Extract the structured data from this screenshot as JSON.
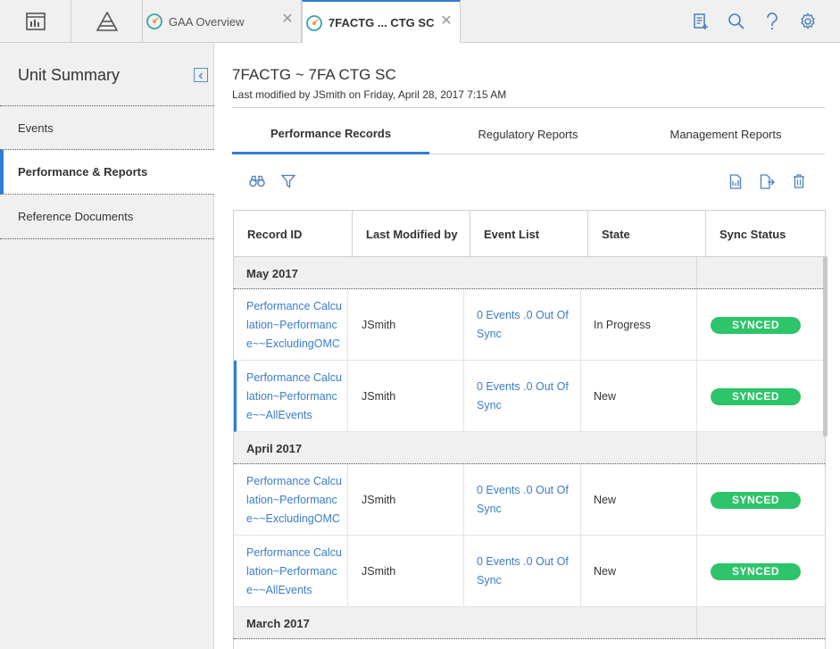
{
  "topbar": {
    "tabs": [
      {
        "label": "GAA Overview",
        "active": false
      },
      {
        "label": "7FACTG ... CTG SC",
        "active": true
      }
    ],
    "close_glyph": "✕"
  },
  "sidebar": {
    "title": "Unit Summary",
    "items": [
      {
        "label": "Events",
        "active": false
      },
      {
        "label": "Performance & Reports",
        "active": true
      },
      {
        "label": "Reference Documents",
        "active": false
      }
    ]
  },
  "main": {
    "title": "7FACTG ~ 7FA CTG SC",
    "subtitle": "Last modified by JSmith on Friday, April 28, 2017 7:15 AM",
    "tabs": [
      {
        "label": "Performance Records",
        "active": true
      },
      {
        "label": "Regulatory Reports",
        "active": false
      },
      {
        "label": "Management Reports",
        "active": false
      }
    ]
  },
  "table": {
    "columns": [
      "Record ID",
      "Last Modified by",
      "Event List",
      "State",
      "Sync Status"
    ],
    "groups": [
      {
        "label": "May 2017",
        "rows": [
          {
            "record_id": "Performance Calculation~Performance~~ExcludingOMC",
            "modified_by": "JSmith",
            "events": "0 Events .0 Out Of Sync",
            "state": "In Progress",
            "sync": "SYNCED"
          },
          {
            "record_id": "Performance Calculation~Performance~~AllEvents",
            "modified_by": "JSmith",
            "events": "0 Events .0 Out Of Sync",
            "state": "New",
            "sync": "SYNCED"
          }
        ]
      },
      {
        "label": "April 2017",
        "rows": [
          {
            "record_id": "Performance Calculation~Performance~~ExcludingOMC",
            "modified_by": "JSmith",
            "events": "0 Events .0 Out Of Sync",
            "state": "New",
            "sync": "SYNCED"
          },
          {
            "record_id": "Performance Calculation~Performance~~AllEvents",
            "modified_by": "JSmith",
            "events": "0 Events .0 Out Of Sync",
            "state": "New",
            "sync": "SYNCED"
          }
        ]
      },
      {
        "label": "March 2017",
        "rows": []
      }
    ]
  },
  "colors": {
    "accent": "#2f7fd3",
    "link": "#3b7dc8",
    "synced": "#2dc46a",
    "sidebar_bg": "#f0f0f0"
  },
  "icons": {
    "topbar_left": [
      "dashboard-icon",
      "pyramid-icon"
    ],
    "topbar_right": [
      "new-record-icon",
      "search-icon",
      "help-icon",
      "settings-icon"
    ],
    "toolbar_left": [
      "binoculars-icon",
      "filter-icon"
    ],
    "toolbar_right": [
      "document-icon",
      "export-icon",
      "delete-icon"
    ]
  }
}
